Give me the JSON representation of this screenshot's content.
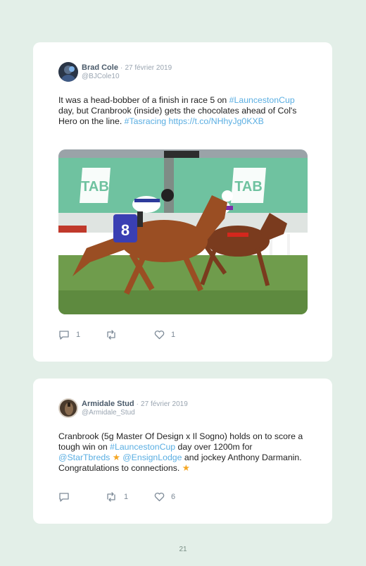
{
  "tweets": [
    {
      "author": "Brad Cole",
      "separator": "·",
      "date": "27 février 2019",
      "handle": "@BJCole10",
      "text": {
        "p1": "It was a head-bobber of a finish in race 5 on ",
        "tag1": "#LauncestonCup",
        "p2": " day, but Cranbrook (inside) gets the chocolates ahead of Col's Hero on the line. ",
        "tag2": "#Tasracing",
        "p3": " ",
        "url": "https://t.co/NHhyJg0KXB"
      },
      "photo": {
        "signage_text_left": "TAB",
        "signage_text_right": "TAB",
        "saddle_number": "8"
      },
      "replies": "1",
      "retweets": "",
      "likes": "1"
    },
    {
      "author": "Armidale Stud",
      "separator": "·",
      "date": "27 février 2019",
      "handle": "@Armidale_Stud",
      "text": {
        "p1": "Cranbrook (5g Master Of Design x Il Sogno) holds on to score a tough win on ",
        "tag1": "#LauncestonCup",
        "p2": " day over 1200m for ",
        "mention1": "@StarTbreds",
        "star1": "★",
        "mention2": "@EnsignLodge",
        "p3": " and jockey Anthony Darmanin. Congratulations to connections. ",
        "star2": "★"
      },
      "replies": "",
      "retweets": "1",
      "likes": "6"
    }
  ],
  "page_number": "21",
  "colors": {
    "background": "#e3efe8",
    "card": "#ffffff",
    "link": "#5aaee2",
    "star": "#f5a623",
    "tab_green": "#6fc2a0"
  }
}
